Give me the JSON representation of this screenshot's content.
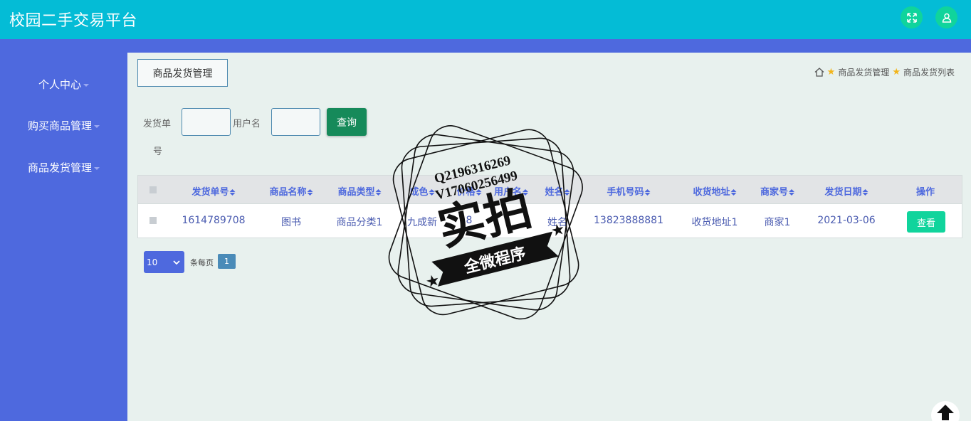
{
  "app": {
    "title": "校园二手交易平台"
  },
  "topbar": {
    "expand_icon": "expand-icon",
    "user_icon": "user-icon",
    "accent": "#04bcd6",
    "button_color": "#10d49c"
  },
  "sidebar": {
    "color": "#4e69de",
    "items": [
      {
        "label": "个人中心"
      },
      {
        "label": "购买商品管理"
      },
      {
        "label": "商品发货管理"
      }
    ]
  },
  "main": {
    "tab_title": "商品发货管理",
    "breadcrumb": {
      "home_icon": "home-icon",
      "items": [
        "商品发货管理",
        "商品发货列表"
      ]
    }
  },
  "search": {
    "order_no_label_1": "发货单",
    "order_no_label_2": "号",
    "order_no_value": "",
    "username_label": "用户名",
    "username_value": "",
    "query_button": "查询"
  },
  "table": {
    "columns": [
      "发货单号",
      "商品名称",
      "商品类型",
      "成色",
      "价格",
      "用户名",
      "姓名",
      "手机号码",
      "收货地址",
      "商家号",
      "发货日期",
      "操作"
    ],
    "rows": [
      {
        "order_no": "1614789708",
        "product_name": "图书",
        "product_type": "商品分类1",
        "condition": "九成新",
        "price": "8",
        "username": "",
        "name": "姓名",
        "phone": "13823888881",
        "address": "收货地址1",
        "merchant": "商家1",
        "date": "2021-03-06",
        "action": "查看"
      }
    ]
  },
  "pagination": {
    "page_size": "10",
    "per_page_label": "条每页",
    "current_page": "1"
  },
  "watermark": {
    "line1": "Q2196316269",
    "line2": "V17060256499",
    "big_text": "实拍",
    "ribbon_text": "全微程序"
  },
  "scroll_top_icon": "arrow-up-icon"
}
